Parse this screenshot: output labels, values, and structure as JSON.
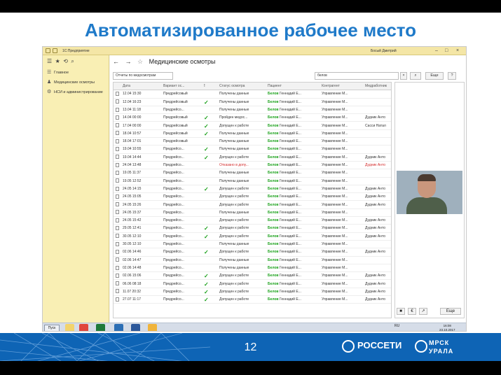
{
  "slide": {
    "title": "Автоматизированное рабочее место",
    "page_number": "12",
    "brand_left": "РОССЕТИ",
    "brand_right_top": "МРСК",
    "brand_right_bottom": "УРАЛА"
  },
  "app": {
    "window_title": "1С:Предприятие",
    "user": "Босый Дмитрий",
    "sidebar": [
      {
        "label": "Главное",
        "icon": "menu-icon"
      },
      {
        "label": "Медицинские осмотры",
        "icon": "people-icon"
      },
      {
        "label": "НСИ и администрирование",
        "icon": "gear-icon"
      }
    ],
    "page_title": "Медицинские осмотры",
    "filter_placeholder": "Отчеты по медосмотрам",
    "search_value": "белов",
    "more_label": "Еще",
    "more_label_video": "Еще",
    "help_label": "?",
    "columns": [
      "Дата",
      "Вариант ос...",
      "!",
      "Статус осмотра",
      "Пациент",
      "Контрагент",
      "Медработник"
    ],
    "rows": [
      {
        "date": "12.04 15:30",
        "variant": "Предрейсовый",
        "ok": "",
        "status": "Получены данные",
        "patient": "Белов",
        "patient_rest": " Геннадий Е...",
        "contractor": "Управление М...",
        "medic": "",
        "red": false
      },
      {
        "date": "12.04 16:23",
        "variant": "Предрейсовый",
        "ok": "✓",
        "status": "Получены данные",
        "patient": "Белов",
        "patient_rest": " Геннадий Е...",
        "contractor": "Управление М...",
        "medic": "",
        "red": false
      },
      {
        "date": "13.04 11:18",
        "variant": "Предрейсо...",
        "ok": "",
        "status": "Получены данные",
        "patient": "Белов",
        "patient_rest": " Геннадий Е...",
        "contractor": "Управление М...",
        "medic": "",
        "red": false
      },
      {
        "date": "14.04 00:00",
        "variant": "Предрейсовый",
        "ok": "✓",
        "status": "Пройден медос...",
        "patient": "Белов",
        "patient_rest": " Геннадий Е...",
        "contractor": "Управление М...",
        "medic": "Дудник Анто",
        "red": false
      },
      {
        "date": "17.04 00:00",
        "variant": "Предрейсовый",
        "ok": "✓",
        "status": "Допущен к работе",
        "patient": "Белов",
        "patient_rest": " Геннадий Е...",
        "contractor": "Управление М...",
        "medic": "Сасси Натал",
        "red": false
      },
      {
        "date": "18.04 10:57",
        "variant": "Предрейсовый",
        "ok": "✓",
        "status": "Получены данные",
        "patient": "Белов",
        "patient_rest": " Геннадий Е...",
        "contractor": "Управление М...",
        "medic": "",
        "red": false
      },
      {
        "date": "18.04 17:01",
        "variant": "Предрейсовый",
        "ok": "",
        "status": "Получены данные",
        "patient": "Белов",
        "patient_rest": " Геннадий Е...",
        "contractor": "Управление М...",
        "medic": "",
        "red": false
      },
      {
        "date": "19.04 10:55",
        "variant": "Предрейсо...",
        "ok": "✓",
        "status": "Получены данные",
        "patient": "Белов",
        "patient_rest": " Геннадий Е...",
        "contractor": "Управление М...",
        "medic": "",
        "red": false
      },
      {
        "date": "19.04 14:44",
        "variant": "Предрейсо...",
        "ok": "✓",
        "status": "Допущен к работе",
        "patient": "Белов",
        "patient_rest": " Геннадий Е...",
        "contractor": "Управление М...",
        "medic": "Дудник Анто",
        "red": false
      },
      {
        "date": "24.04 13:48",
        "variant": "Предрейсо...",
        "ok": "",
        "status": "Отказано в допу...",
        "patient": "Белов",
        "patient_rest": " Геннадий Е...",
        "contractor": "Управление М...",
        "medic": "Дудник Анто",
        "red": true
      },
      {
        "date": "19.05 11:37",
        "variant": "Предрейсо...",
        "ok": "",
        "status": "Получены данные",
        "patient": "Белов",
        "patient_rest": " Геннадий Е...",
        "contractor": "Управление М...",
        "medic": "",
        "red": false
      },
      {
        "date": "19.05 12:52",
        "variant": "Предрейсо...",
        "ok": "",
        "status": "Получены данные",
        "patient": "Белов",
        "patient_rest": " Геннадий Е...",
        "contractor": "Управление М...",
        "medic": "",
        "red": false
      },
      {
        "date": "24.05 14:15",
        "variant": "Предрейсо...",
        "ok": "✓",
        "status": "Допущен к работе",
        "patient": "Белов",
        "patient_rest": " Геннадий Е...",
        "contractor": "Управление М...",
        "medic": "Дудник Анто",
        "red": false
      },
      {
        "date": "24.05 15:05",
        "variant": "Предрейсо...",
        "ok": "",
        "status": "Допущен к работе",
        "patient": "Белов",
        "patient_rest": " Геннадий Е...",
        "contractor": "Управление М...",
        "medic": "Дудник Анто",
        "red": false
      },
      {
        "date": "24.05 15:26",
        "variant": "Предрейсо...",
        "ok": "",
        "status": "Допущен к работе",
        "patient": "Белов",
        "patient_rest": " Геннадий Е...",
        "contractor": "Управление М...",
        "medic": "Дудник Анто",
        "red": false
      },
      {
        "date": "24.05 15:37",
        "variant": "Предрейсо...",
        "ok": "",
        "status": "Получены данные",
        "patient": "Белов",
        "patient_rest": " Геннадий Е...",
        "contractor": "Управление М...",
        "medic": "",
        "red": false
      },
      {
        "date": "24.05 15:42",
        "variant": "Предрейсо...",
        "ok": "",
        "status": "Допущен к работе",
        "patient": "Белов",
        "patient_rest": " Геннадий Е...",
        "contractor": "Управление М...",
        "medic": "Дудник Анто",
        "red": false
      },
      {
        "date": "29.05 12:41",
        "variant": "Предрейсо...",
        "ok": "✓",
        "status": "Допущен к работе",
        "patient": "Белов",
        "patient_rest": " Геннадий Е...",
        "contractor": "Управление М...",
        "medic": "Дудник Анто",
        "red": false
      },
      {
        "date": "30.05 12:10",
        "variant": "Предрейсо...",
        "ok": "✓",
        "status": "Допущен к работе",
        "patient": "Белов",
        "patient_rest": " Геннадий Е...",
        "contractor": "Управление М...",
        "medic": "Дудник Анто",
        "red": false
      },
      {
        "date": "30.05 12:10",
        "variant": "Предрейсо...",
        "ok": "",
        "status": "Получены данные",
        "patient": "Белов",
        "patient_rest": " Геннадий Е...",
        "contractor": "Управление М...",
        "medic": "",
        "red": false
      },
      {
        "date": "02.06 14:46",
        "variant": "Предрейсо...",
        "ok": "✓",
        "status": "Допущен к работе",
        "patient": "Белов",
        "patient_rest": " Геннадий Е...",
        "contractor": "Управление М...",
        "medic": "Дудник Анто",
        "red": false
      },
      {
        "date": "02.06 14:47",
        "variant": "Предрейсо...",
        "ok": "",
        "status": "Получены данные",
        "patient": "Белов",
        "patient_rest": " Геннадий Е...",
        "contractor": "Управление М...",
        "medic": "",
        "red": false
      },
      {
        "date": "02.06 14:48",
        "variant": "Предрейсо...",
        "ok": "",
        "status": "Получены данные",
        "patient": "Белов",
        "patient_rest": " Геннадий Е...",
        "contractor": "Управление М...",
        "medic": "",
        "red": false
      },
      {
        "date": "02.06 15:06",
        "variant": "Предрейсо...",
        "ok": "✓",
        "status": "Допущен к работе",
        "patient": "Белов",
        "patient_rest": " Геннадий Е...",
        "contractor": "Управление М...",
        "medic": "Дудник Анто",
        "red": false
      },
      {
        "date": "06.06 08:18",
        "variant": "Предрейсо...",
        "ok": "✓",
        "status": "Допущен к работе",
        "patient": "Белов",
        "patient_rest": " Геннадий Е...",
        "contractor": "Управление М...",
        "medic": "Дудник Анто",
        "red": false
      },
      {
        "date": "11.07 20:32",
        "variant": "Предрейсо...",
        "ok": "✓",
        "status": "Допущен к работе",
        "patient": "Белов",
        "patient_rest": " Геннадий Е...",
        "contractor": "Управление М...",
        "medic": "Дудник Анто",
        "red": false
      },
      {
        "date": "27.07 11:17",
        "variant": "Предрейсо...",
        "ok": "✓",
        "status": "Допущен к работе",
        "patient": "Белов",
        "patient_rest": " Геннадий Е...",
        "contractor": "Управление М...",
        "medic": "Дудник Анто",
        "red": false
      }
    ],
    "taskbar": {
      "start_label": "Пуск",
      "tray_lang": "RU",
      "clock_time": "16:08",
      "clock_date": "23.10.2017"
    },
    "colors": {
      "accent_title": "#1f7ac9",
      "check_green": "#19a019",
      "refuse_red": "#d42b2b",
      "sidebar_yellow": "#f9efb4",
      "footer_blue": "#0e64b5"
    }
  }
}
